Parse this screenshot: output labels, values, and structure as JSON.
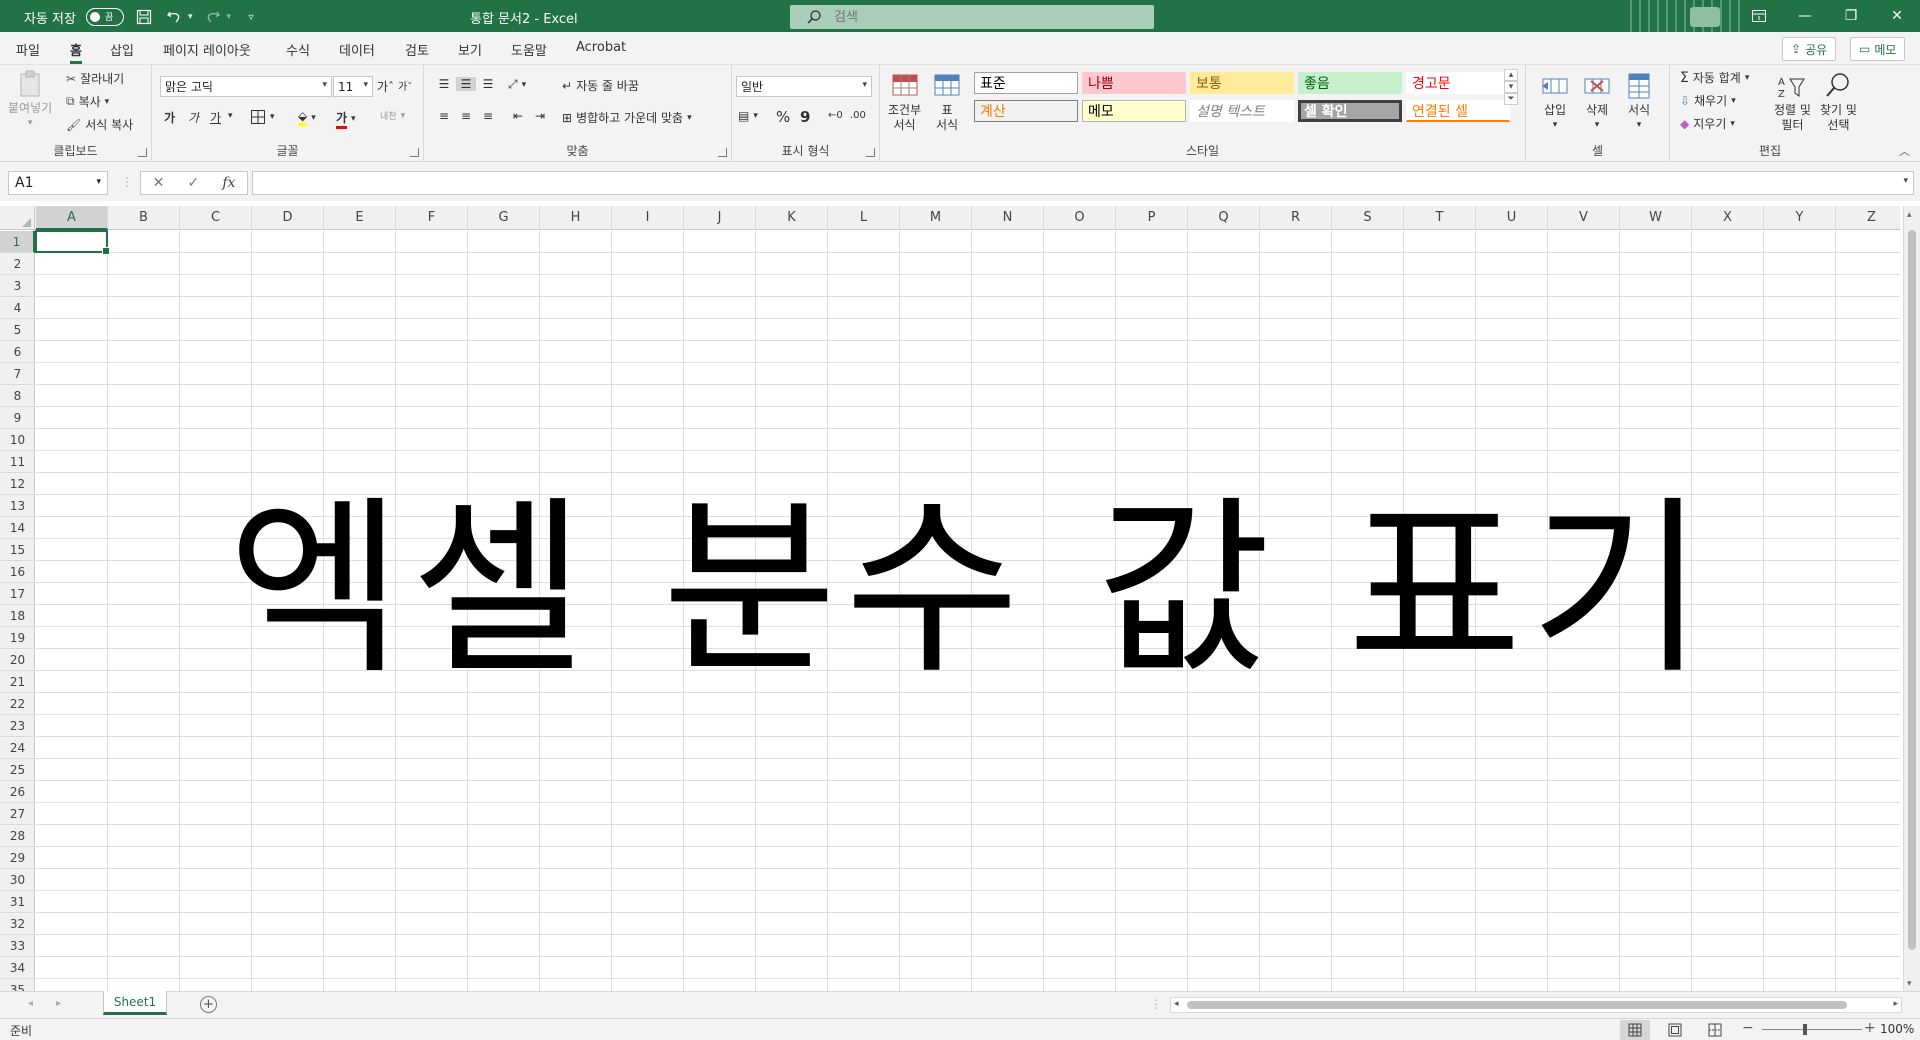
{
  "titlebar": {
    "autosave_label": "자동 저장",
    "autosave_state": "끔",
    "doc_title": "통합 문서2 - Excel",
    "search_placeholder": "검색",
    "accent": "#217346"
  },
  "menu": {
    "tabs": [
      "파일",
      "홈",
      "삽입",
      "페이지 레이아웃",
      "수식",
      "데이터",
      "검토",
      "보기",
      "도움말",
      "Acrobat"
    ],
    "active_tab": "홈",
    "share": "공유",
    "memo": "메모"
  },
  "ribbon": {
    "clipboard": {
      "paste": "붙여넣기",
      "cut": "잘라내기",
      "copy": "복사",
      "format_painter": "서식 복사",
      "label": "클립보드"
    },
    "font": {
      "name": "맑은 고딕",
      "size": "11",
      "grow": "가ˆ",
      "shrink": "가ˇ",
      "bold": "가",
      "italic": "가",
      "underline": "가",
      "font_color_glyph": "가",
      "phonetic": "내천",
      "label": "글꼴"
    },
    "alignment": {
      "wrap": "자동 줄 바꿈",
      "merge": "병합하고 가운데 맞춤",
      "label": "맞춤"
    },
    "number": {
      "format": "일반",
      "percent": "%",
      "comma": "9",
      "label": "표시 형식"
    },
    "styles": {
      "conditional": "조건부",
      "conditional2": "서식",
      "table": "표",
      "table2": "서식",
      "cells": [
        {
          "text": "표준",
          "bg": "#ffffff",
          "color": "#000000",
          "border": "#a0a0a0"
        },
        {
          "text": "나쁨",
          "bg": "#ffc7ce",
          "color": "#9c0006",
          "border": "#ffc7ce"
        },
        {
          "text": "보통",
          "bg": "#ffeb9c",
          "color": "#9c5700",
          "border": "#ffeb9c"
        },
        {
          "text": "좋음",
          "bg": "#c6efce",
          "color": "#006100",
          "border": "#c6efce"
        },
        {
          "text": "경고문",
          "bg": "#ffffff",
          "color": "#ff0000",
          "border": "#ffffff"
        },
        {
          "text": "계산",
          "bg": "#f2f2f2",
          "color": "#fa7d00",
          "border": "#7f7f7f"
        },
        {
          "text": "메모",
          "bg": "#ffffcc",
          "color": "#000000",
          "border": "#b2b2b2"
        },
        {
          "text": "설명 텍스트",
          "bg": "#ffffff",
          "color": "#7f7f7f",
          "border": "#ffffff"
        },
        {
          "text": "셀 확인",
          "bg": "#a5a5a5",
          "color": "#ffffff",
          "border": "#3f3f3f"
        },
        {
          "text": "연결된 셀",
          "bg": "#ffffff",
          "color": "#fa7d00",
          "border": "#ffffff"
        }
      ],
      "label": "스타일"
    },
    "cells": {
      "insert": "삽입",
      "delete": "삭제",
      "format": "서식",
      "label": "셀"
    },
    "editing": {
      "autosum": "자동 합계",
      "fill": "채우기",
      "clear": "지우기",
      "sort": "정렬 및",
      "sort2": "필터",
      "find": "찾기 및",
      "find2": "선택",
      "label": "편집"
    }
  },
  "formulabar": {
    "namebox": "A1",
    "cancel": "✕",
    "enter": "✓",
    "fx": "fx",
    "value": ""
  },
  "grid": {
    "columns": [
      "A",
      "B",
      "C",
      "D",
      "E",
      "F",
      "G",
      "H",
      "I",
      "J",
      "K",
      "L",
      "M",
      "N",
      "O",
      "P",
      "Q",
      "R",
      "S",
      "T",
      "U",
      "V",
      "W",
      "X",
      "Y",
      "Z"
    ],
    "rows": [
      "1",
      "2",
      "3",
      "4",
      "5",
      "6",
      "7",
      "8",
      "9",
      "10",
      "11",
      "12",
      "13",
      "14",
      "15",
      "16",
      "17",
      "18",
      "19",
      "20",
      "21",
      "22",
      "23",
      "24",
      "25",
      "26",
      "27",
      "28",
      "29",
      "30",
      "31",
      "32",
      "33",
      "34",
      "35"
    ],
    "active_cell": "A1"
  },
  "overlay_title": "엑셀 분수 값 표기",
  "sheets": {
    "tabs": [
      "Sheet1"
    ],
    "add": "+"
  },
  "status": {
    "text": "준비",
    "zoom": "100%",
    "zoom_minus": "−",
    "zoom_plus": "+"
  }
}
